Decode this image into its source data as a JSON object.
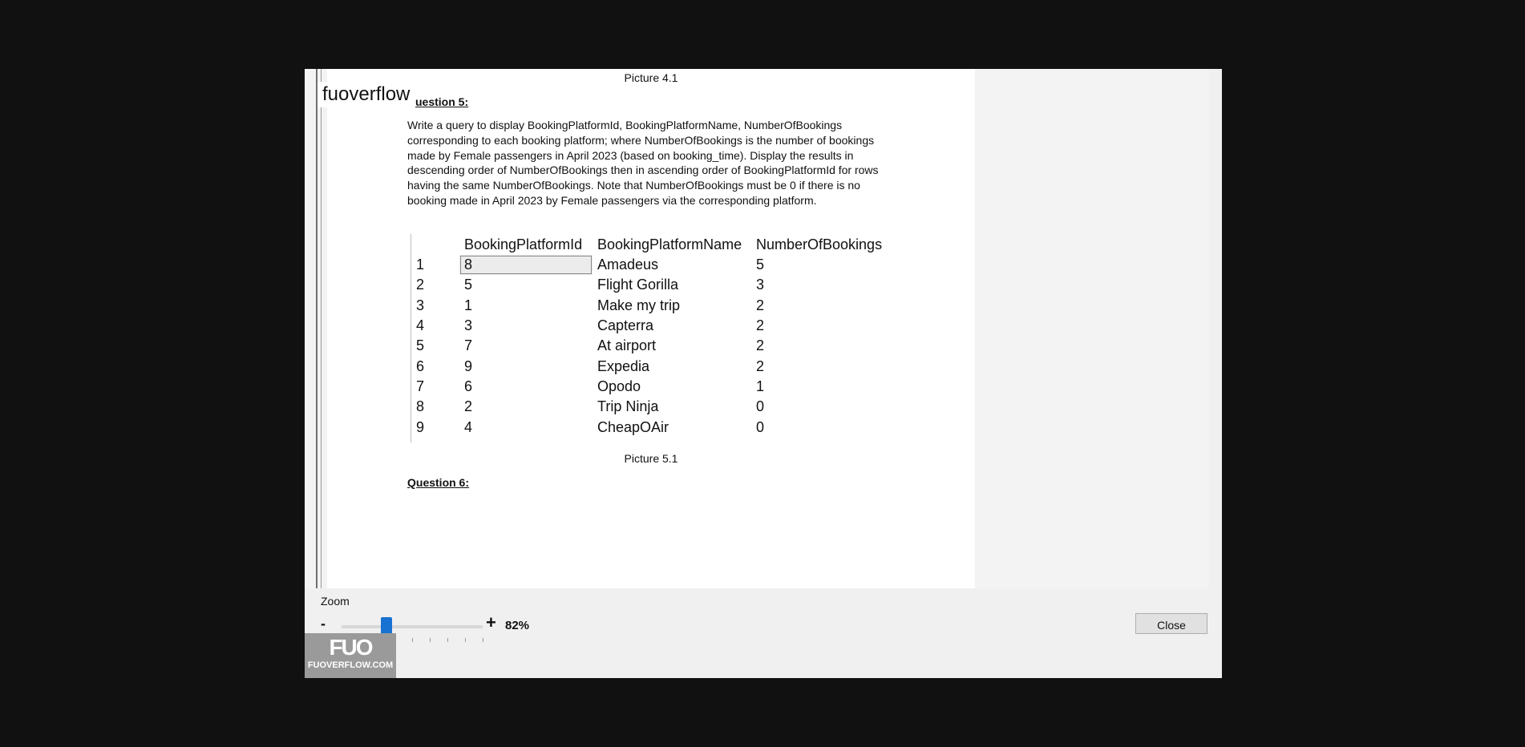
{
  "document": {
    "picture_prev_caption": "Picture 4.1",
    "question5_heading": "uestion 5:",
    "question5_text": "Write a query to display BookingPlatformId, BookingPlatformName, NumberOfBookings corresponding to each booking platform; where NumberOfBookings is the number of bookings made by Female passengers in April 2023 (based on booking_time). Display the results in descending order of NumberOfBookings then in ascending order of BookingPlatformId for rows having the same NumberOfBookings. Note that NumberOfBookings must be 0 if there is no booking made in April 2023 by Female passengers via the corresponding platform.",
    "picture_caption": "Picture 5.1",
    "question6_heading": "Question 6:"
  },
  "result_table": {
    "headers": [
      "",
      "BookingPlatformId",
      "BookingPlatformName",
      "NumberOfBookings"
    ],
    "rows": [
      [
        "1",
        "8",
        "Amadeus",
        "5"
      ],
      [
        "2",
        "5",
        "Flight Gorilla",
        "3"
      ],
      [
        "3",
        "1",
        "Make my trip",
        "2"
      ],
      [
        "4",
        "3",
        "Capterra",
        "2"
      ],
      [
        "5",
        "7",
        "At airport",
        "2"
      ],
      [
        "6",
        "9",
        "Expedia",
        "2"
      ],
      [
        "7",
        "6",
        "Opodo",
        "1"
      ],
      [
        "8",
        "2",
        "Trip Ninja",
        "0"
      ],
      [
        "9",
        "4",
        "CheapOAir",
        "0"
      ]
    ]
  },
  "watermark": {
    "brand": "fuoverflow",
    "logo_mark": "FUO",
    "logo_text": "FUOVERFLOW.COM"
  },
  "zoom": {
    "label": "Zoom",
    "minus": "-",
    "plus": "+",
    "value": "82%",
    "level_fraction": 0.32
  },
  "dialog": {
    "close_label": "Close"
  },
  "icons": {
    "scroll_down": "chevron-down-icon"
  },
  "colors": {
    "slider_thumb": "#1872d2",
    "background": "#111111"
  }
}
